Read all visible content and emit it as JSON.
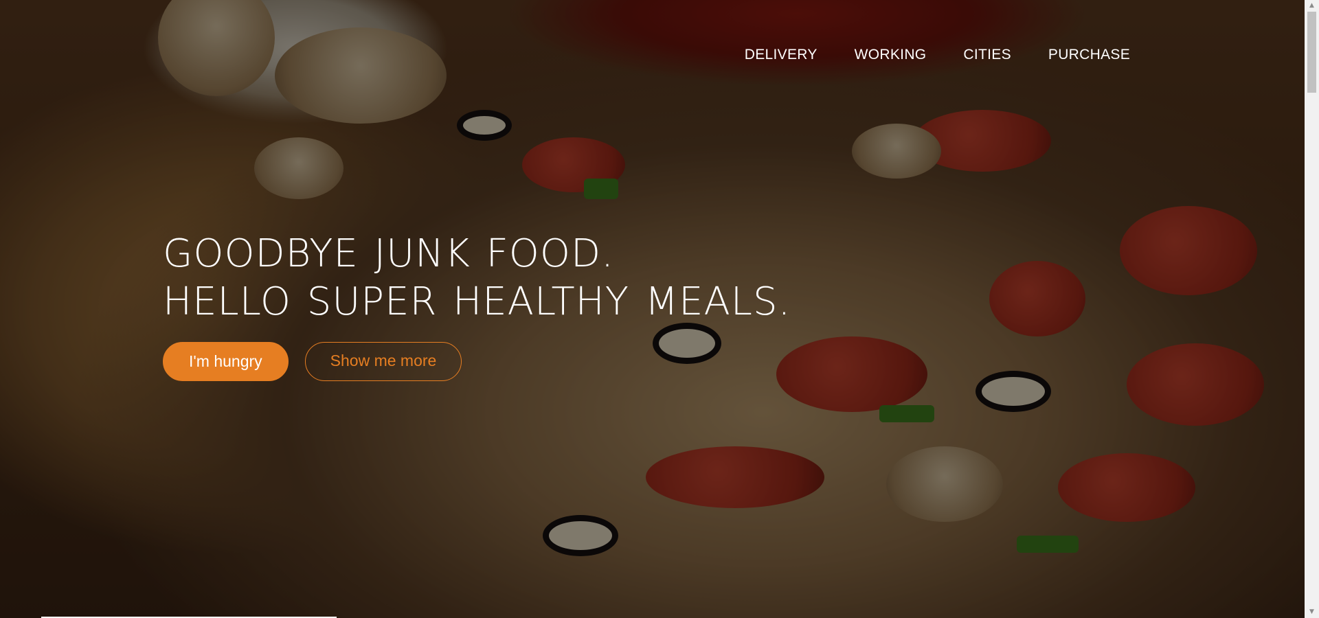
{
  "nav": {
    "items": [
      {
        "label": "DELIVERY"
      },
      {
        "label": "WORKING"
      },
      {
        "label": "CITIES"
      },
      {
        "label": "PURCHASE"
      }
    ]
  },
  "hero": {
    "title_line1": "GOODBYE JUNK FOOD.",
    "title_line2": "HELLO SUPER HEALTHY MEALS.",
    "primary_button": "I'm hungry",
    "secondary_button": "Show me more",
    "background_image": "pizza-photo"
  },
  "colors": {
    "accent": "#e67e22",
    "text": "#ffffff",
    "overlay": "rgba(0,0,0,0.45)"
  },
  "scrollbar": {
    "up_icon": "chevron-up-icon",
    "down_icon": "chevron-down-icon"
  }
}
